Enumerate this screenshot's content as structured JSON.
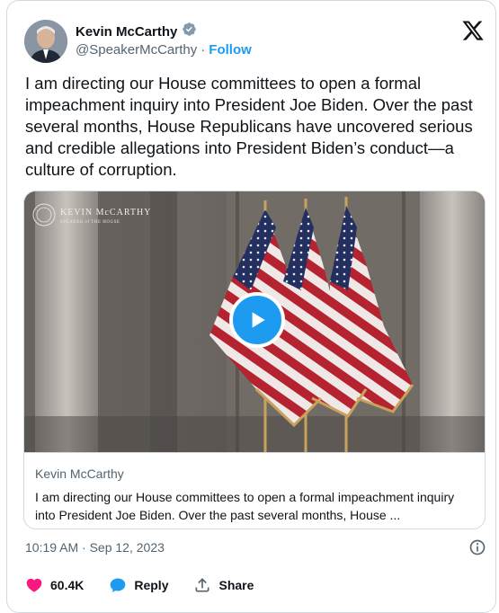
{
  "author": {
    "name": "Kevin McCarthy",
    "handle": "@SpeakerMcCarthy",
    "separator": "·",
    "follow_label": "Follow"
  },
  "tweet": {
    "text": "I am directing our House committees to open a formal impeachment inquiry into President Joe Biden. Over the past several months, House Republicans have uncovered serious and credible allegations into President Biden’s conduct—a culture of corruption."
  },
  "media": {
    "watermark_name": "KEVIN McCARTHY",
    "watermark_title": "SPEAKER of THE HOUSE",
    "card_source": "Kevin McCarthy",
    "card_description": "I am directing our House committees to open a formal impeachment inquiry into President Joe Biden. Over the past several months, House ..."
  },
  "timestamp": "10:19 AM · Sep 12, 2023",
  "actions": {
    "likes": "60.4K",
    "reply_label": "Reply",
    "share_label": "Share"
  },
  "colors": {
    "accent": "#1d9bf0",
    "like": "#f91880",
    "muted": "#536471",
    "border": "#cfd9de"
  },
  "icons": [
    "verified-badge-icon",
    "x-logo-icon",
    "play-icon",
    "info-icon",
    "heart-icon",
    "reply-bubble-icon",
    "share-icon"
  ]
}
